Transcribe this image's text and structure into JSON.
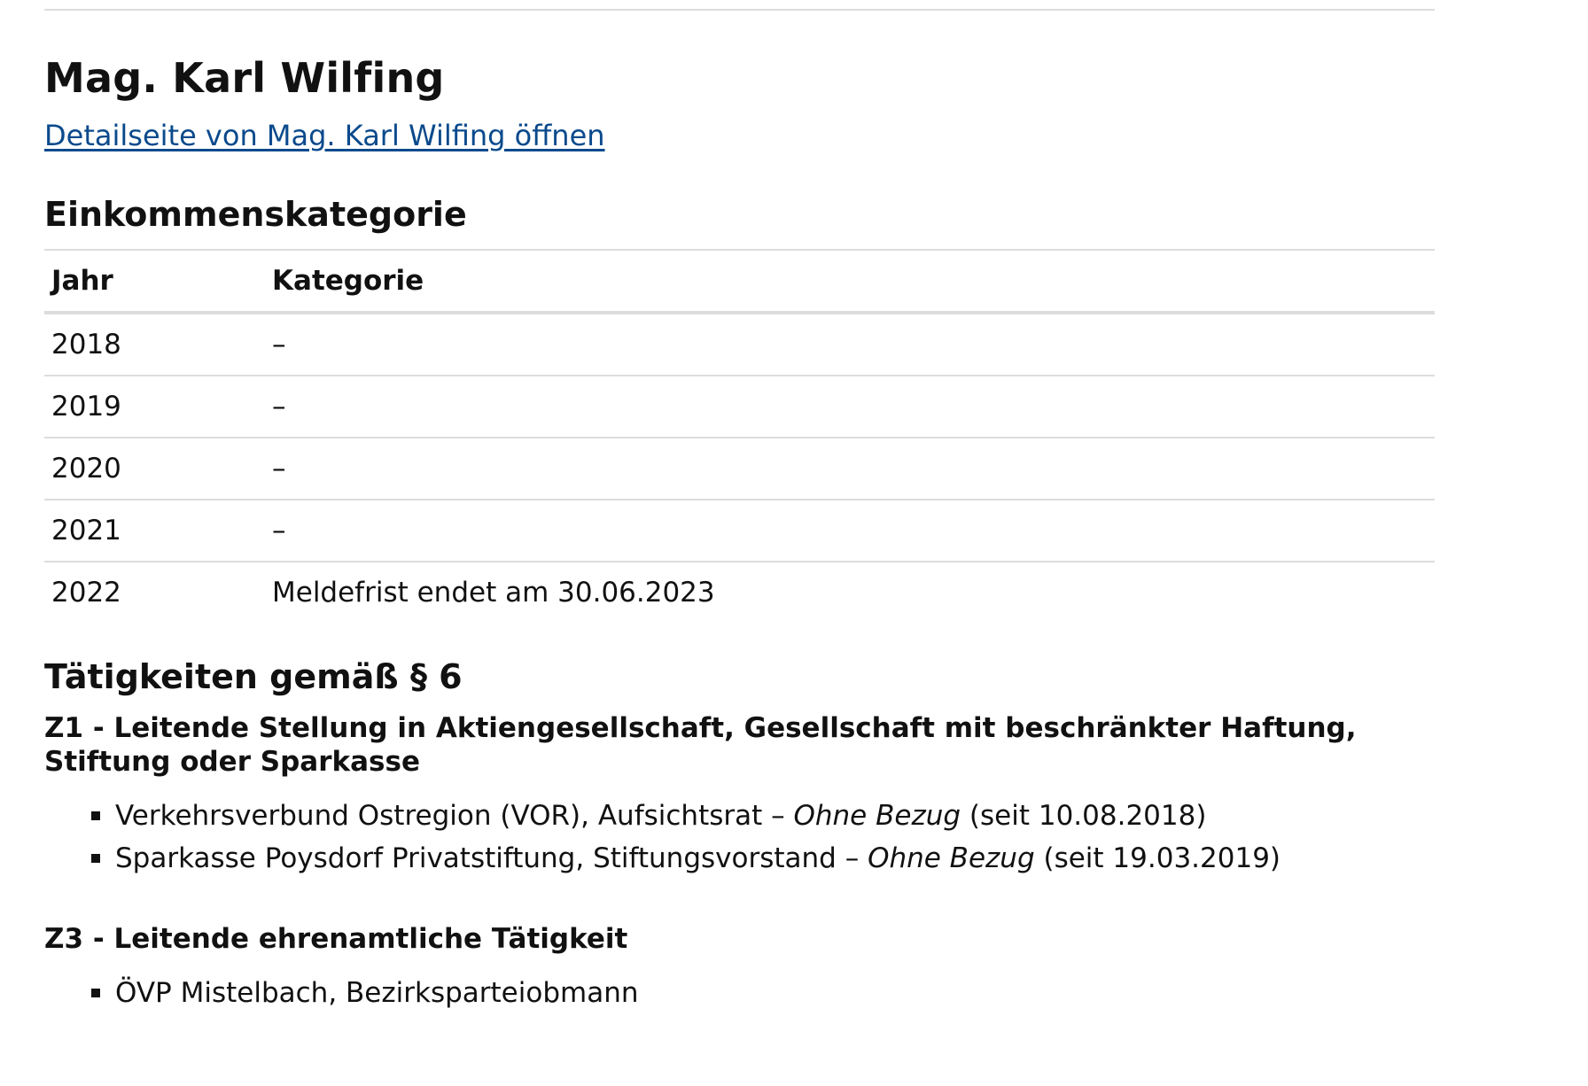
{
  "person": {
    "name": "Mag. Karl Wilfing",
    "detail_link": "Detailseite von Mag. Karl Wilfing öffnen"
  },
  "income": {
    "title": "Einkommenskategorie",
    "columns": [
      "Jahr",
      "Kategorie"
    ],
    "rows": [
      {
        "year": "2018",
        "category": "–"
      },
      {
        "year": "2019",
        "category": "–"
      },
      {
        "year": "2020",
        "category": "–"
      },
      {
        "year": "2021",
        "category": "–"
      },
      {
        "year": "2022",
        "category": "Meldefrist endet am 30.06.2023"
      }
    ]
  },
  "activities": {
    "title": "Tätigkeiten gemäß § 6",
    "groups": [
      {
        "title": "Z1 - Leitende Stellung in Aktiengesellschaft, Gesellschaft mit beschränkter Haftung, Stiftung oder Sparkasse",
        "items": [
          {
            "text": "Verkehrsverbund Ostregion (VOR), Aufsichtsrat – ",
            "emph": "Ohne Bezug",
            "suffix": " (seit 10.08.2018)"
          },
          {
            "text": "Sparkasse Poysdorf Privatstiftung, Stiftungsvorstand – ",
            "emph": "Ohne Bezug",
            "suffix": " (seit 19.03.2019)"
          }
        ]
      },
      {
        "title": "Z3 - Leitende ehrenamtliche Tätigkeit",
        "items": [
          {
            "text": "ÖVP Mistelbach, Bezirksparteiobmann",
            "emph": "",
            "suffix": ""
          }
        ]
      }
    ]
  }
}
